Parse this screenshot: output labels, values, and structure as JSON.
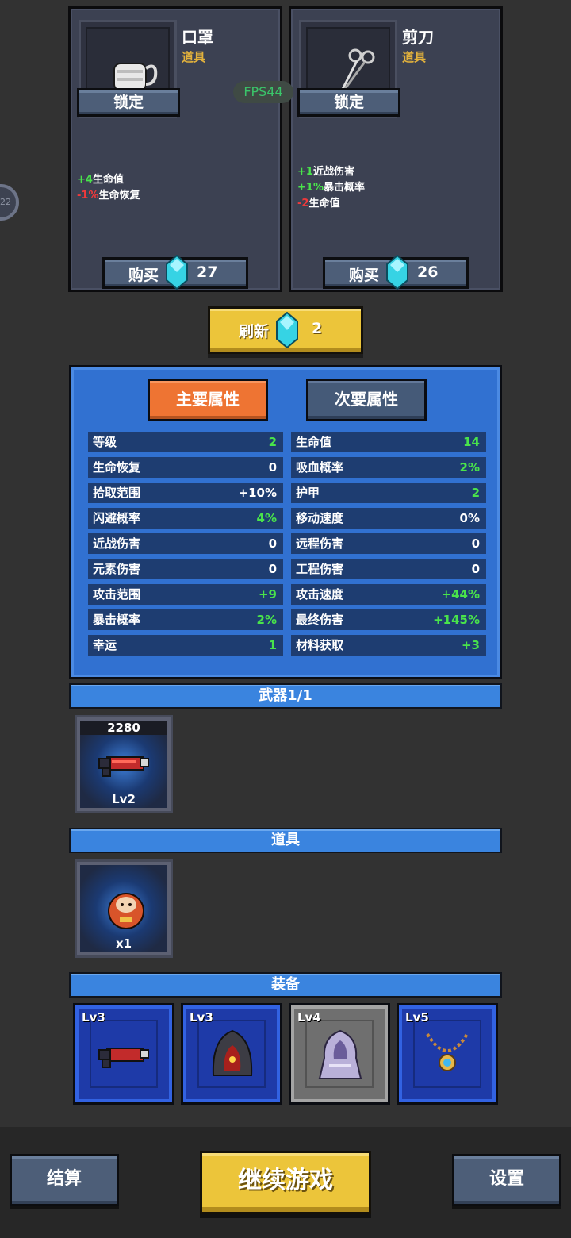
{
  "shop": {
    "items": [
      {
        "name": "口罩",
        "type": "道具",
        "lock_label": "锁定",
        "effects": [
          {
            "value": "+4",
            "value_color": "green",
            "label": "生命值"
          },
          {
            "value": "-1%",
            "value_color": "red",
            "label": "生命恢复"
          }
        ],
        "buy_label": "购买",
        "price": "27"
      },
      {
        "name": "剪刀",
        "type": "道具",
        "lock_label": "锁定",
        "effects": [
          {
            "value": "+1",
            "value_color": "green",
            "label": "近战伤害"
          },
          {
            "value": "+1%",
            "value_color": "green",
            "label": "暴击概率"
          },
          {
            "value": "-2",
            "value_color": "red",
            "label": "生命值"
          }
        ],
        "buy_label": "购买",
        "price": "26"
      }
    ],
    "fps_label": "FPS44",
    "side_badge": "22"
  },
  "refresh": {
    "label": "刷新",
    "cost": "2"
  },
  "stats": {
    "tabs": [
      {
        "label": "主要属性",
        "active": true
      },
      {
        "label": "次要属性",
        "active": false
      }
    ],
    "left": [
      {
        "key": "等级",
        "value": "2",
        "color": "green"
      },
      {
        "key": "生命恢复",
        "value": "0",
        "color": "white"
      },
      {
        "key": "拾取范围",
        "value": "+10%",
        "color": "white"
      },
      {
        "key": "闪避概率",
        "value": "4%",
        "color": "green"
      },
      {
        "key": "近战伤害",
        "value": "0",
        "color": "white"
      },
      {
        "key": "元素伤害",
        "value": "0",
        "color": "white"
      },
      {
        "key": "攻击范围",
        "value": "+9",
        "color": "green"
      },
      {
        "key": "暴击概率",
        "value": "2%",
        "color": "green"
      },
      {
        "key": "幸运",
        "value": "1",
        "color": "green"
      }
    ],
    "right": [
      {
        "key": "生命值",
        "value": "14",
        "color": "green"
      },
      {
        "key": "吸血概率",
        "value": "2%",
        "color": "green"
      },
      {
        "key": "护甲",
        "value": "2",
        "color": "green"
      },
      {
        "key": "移动速度",
        "value": "0%",
        "color": "white"
      },
      {
        "key": "远程伤害",
        "value": "0",
        "color": "white"
      },
      {
        "key": "工程伤害",
        "value": "0",
        "color": "white"
      },
      {
        "key": "攻击速度",
        "value": "+44%",
        "color": "green"
      },
      {
        "key": "最终伤害",
        "value": "+145%",
        "color": "green"
      },
      {
        "key": "材料获取",
        "value": "+3",
        "color": "green"
      }
    ]
  },
  "weapons": {
    "title": "武器1/1",
    "items": [
      {
        "top_value": "2280",
        "level": "Lv2",
        "icon": "blaster-gun-icon"
      }
    ]
  },
  "props": {
    "title": "道具",
    "items": [
      {
        "count": "x1",
        "icon": "daruma-doll-icon"
      }
    ]
  },
  "equipment": {
    "title": "装备",
    "items": [
      {
        "level": "Lv3",
        "icon": "blaster-gun-icon",
        "frame": "blue"
      },
      {
        "level": "Lv3",
        "icon": "hooded-cloak-icon",
        "frame": "blue"
      },
      {
        "level": "Lv4",
        "icon": "ghost-robe-icon",
        "frame": "gray"
      },
      {
        "level": "Lv5",
        "icon": "amulet-necklace-icon",
        "frame": "blue"
      }
    ]
  },
  "footer": {
    "settle_label": "结算",
    "continue_label": "继续游戏",
    "settings_label": "设置"
  },
  "colors": {
    "accent_yellow": "#ecc53a",
    "panel_blue": "#3171d1",
    "tab_orange": "#ee7433",
    "stat_green": "#49e34b",
    "stat_red": "#f0393b",
    "item_type_gold": "#e3b23c"
  }
}
